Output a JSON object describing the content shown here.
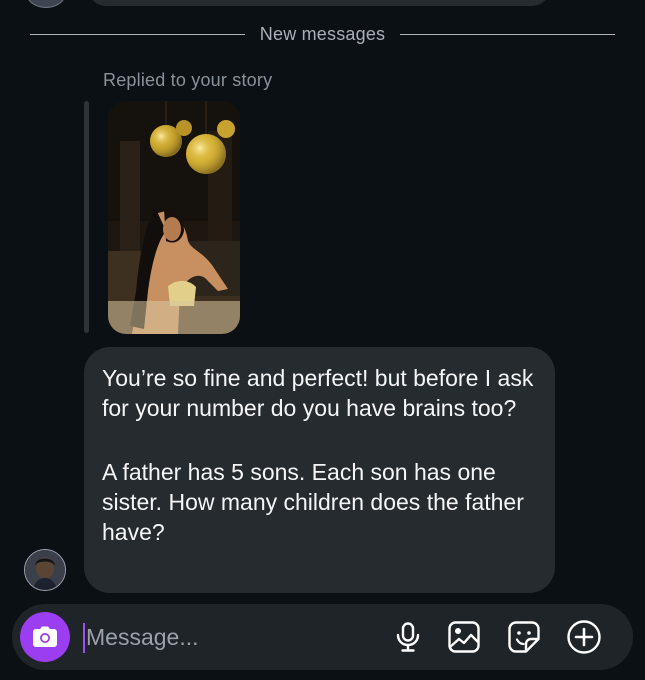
{
  "divider": {
    "label": "New messages"
  },
  "reply": {
    "label": "Replied to your story"
  },
  "message": {
    "paragraph1": "You’re so fine and perfect! but before I ask for your number do you have brains too?",
    "paragraph2": "A father has 5 sons. Each son has one sister. How many children does the father have?"
  },
  "composer": {
    "placeholder": "Message...",
    "value": ""
  },
  "icons": {
    "camera": "camera-icon",
    "microphone": "microphone-icon",
    "gallery": "gallery-icon",
    "sticker": "sticker-icon",
    "add": "plus-circle-icon"
  },
  "colors": {
    "background": "#0b1014",
    "bubble": "#262b30",
    "accent": "#9b3df0",
    "text": "#f4f5f6",
    "muted": "#8a9299"
  }
}
